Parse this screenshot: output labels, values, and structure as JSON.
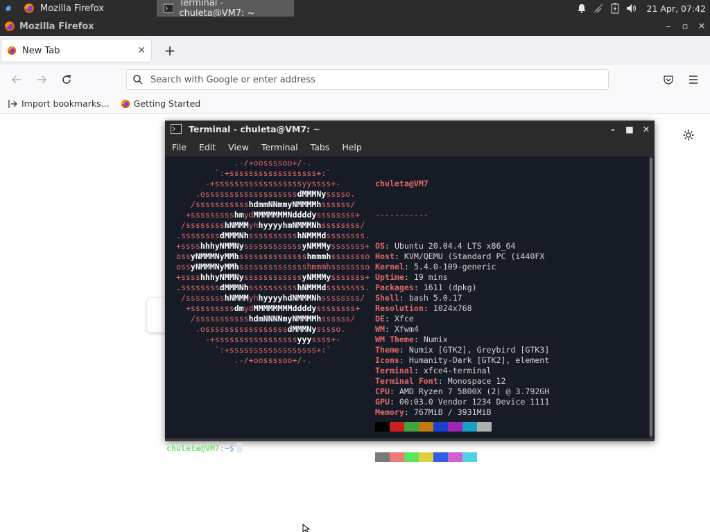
{
  "panel": {
    "tasks": [
      {
        "label": "Mozilla Firefox",
        "icon": "firefox-icon"
      },
      {
        "label": "Terminal - chuleta@VM7: ~",
        "icon": "terminal-icon"
      }
    ],
    "clock": "21 Apr, 07:42"
  },
  "firefox": {
    "window_title": "Mozilla Firefox",
    "tab_label": "New Tab",
    "search_placeholder": "Search with Google or enter address",
    "bookmarks": [
      "Import bookmarks...",
      "Getting Started"
    ]
  },
  "terminal": {
    "title": "Terminal - chuleta@VM7: ~",
    "menu": [
      "File",
      "Edit",
      "View",
      "Terminal",
      "Tabs",
      "Help"
    ],
    "logo_lines": [
      [
        [
          "              .-/+oossssoo+/-.",
          0
        ]
      ],
      [
        [
          "          `:+ssssssssssssssssss+:`",
          0
        ]
      ],
      [
        [
          "        -+ssssssssssssssssssyyssss+-",
          0
        ]
      ],
      [
        [
          "      .osssssssssssssssssss",
          0
        ],
        [
          "dMMMNy",
          1
        ],
        [
          "sssso.",
          0
        ]
      ],
      [
        [
          "     /sssssssssss",
          0
        ],
        [
          "hdmmNNmmyNMMMMh",
          1
        ],
        [
          "ssssss/",
          0
        ]
      ],
      [
        [
          "    +sssssssss",
          0
        ],
        [
          "hm",
          1
        ],
        [
          "yd",
          0
        ],
        [
          "MMMMMMMNddddy",
          1
        ],
        [
          "ssssssss+",
          0
        ]
      ],
      [
        [
          "   /ssssssss",
          0
        ],
        [
          "hNMMM",
          1
        ],
        [
          "yh",
          0
        ],
        [
          "hyyyyhmNMMMNh",
          1
        ],
        [
          "ssssssss/",
          0
        ]
      ],
      [
        [
          "  .ssssssss",
          0
        ],
        [
          "dMMMNh",
          1
        ],
        [
          "ssssssssss",
          0
        ],
        [
          "hNMMMd",
          1
        ],
        [
          "ssssssss.",
          0
        ]
      ],
      [
        [
          "  +ssss",
          0
        ],
        [
          "hhhyNMMNy",
          1
        ],
        [
          "ssssssssssss",
          0
        ],
        [
          "yNMMMy",
          1
        ],
        [
          "sssssss+",
          0
        ]
      ],
      [
        [
          "  oss",
          0
        ],
        [
          "yNMMMNyMMh",
          1
        ],
        [
          "ssssssssssssss",
          0
        ],
        [
          "hmmmh",
          1
        ],
        [
          "ssssssso",
          0
        ]
      ],
      [
        [
          "  oss",
          0
        ],
        [
          "yNMMMNyMMh",
          1
        ],
        [
          "sssssssssssssshmmmhssssssso",
          0
        ]
      ],
      [
        [
          "  +ssss",
          0
        ],
        [
          "hhhyNMMNy",
          1
        ],
        [
          "ssssssssssss",
          0
        ],
        [
          "yNMMMy",
          1
        ],
        [
          "sssssss+",
          0
        ]
      ],
      [
        [
          "  .ssssssss",
          0
        ],
        [
          "dMMMNh",
          1
        ],
        [
          "ssssssssss",
          0
        ],
        [
          "hNMMMd",
          1
        ],
        [
          "ssssssss.",
          0
        ]
      ],
      [
        [
          "   /ssssssss",
          0
        ],
        [
          "hNMMM",
          1
        ],
        [
          "yh",
          0
        ],
        [
          "hyyyyhdNMMMNh",
          1
        ],
        [
          "ssssssss/",
          0
        ]
      ],
      [
        [
          "    +sssssssss",
          0
        ],
        [
          "dm",
          1
        ],
        [
          "yd",
          0
        ],
        [
          "MMMMMMMMddddy",
          1
        ],
        [
          "ssssssss+",
          0
        ]
      ],
      [
        [
          "     /sssssssssss",
          0
        ],
        [
          "hdmNNNNmyNMMMMh",
          1
        ],
        [
          "ssssss/",
          0
        ]
      ],
      [
        [
          "      .osssssssssssssssss",
          0
        ],
        [
          "dMMMNy",
          1
        ],
        [
          "sssso.",
          0
        ]
      ],
      [
        [
          "        -+sssssssssssssssss",
          0
        ],
        [
          "yyy",
          1
        ],
        [
          "ssss+-",
          0
        ]
      ],
      [
        [
          "          `:+ssssssssssssssssss+:`",
          0
        ]
      ],
      [
        [
          "              .-/+oossssoo+/-.",
          0
        ]
      ]
    ],
    "userhost": "chuleta@VM7",
    "separator": "-----------",
    "info": [
      {
        "key": "OS",
        "value": "Ubuntu 20.04.4 LTS x86_64"
      },
      {
        "key": "Host",
        "value": "KVM/QEMU (Standard PC (i440FX"
      },
      {
        "key": "Kernel",
        "value": "5.4.0-109-generic"
      },
      {
        "key": "Uptime",
        "value": "19 mins"
      },
      {
        "key": "Packages",
        "value": "1611 (dpkg)"
      },
      {
        "key": "Shell",
        "value": "bash 5.0.17"
      },
      {
        "key": "Resolution",
        "value": "1024x768"
      },
      {
        "key": "DE",
        "value": "Xfce"
      },
      {
        "key": "WM",
        "value": "Xfwm4"
      },
      {
        "key": "WM Theme",
        "value": "Numix"
      },
      {
        "key": "Theme",
        "value": "Numix [GTK2], Greybird [GTK3]"
      },
      {
        "key": "Icons",
        "value": "Humanity-Dark [GTK2], element"
      },
      {
        "key": "Terminal",
        "value": "xfce4-terminal"
      },
      {
        "key": "Terminal Font",
        "value": "Monospace 12"
      },
      {
        "key": "CPU",
        "value": "AMD Ryzen 7 5800X (2) @ 3.792GH"
      },
      {
        "key": "GPU",
        "value": "00:03.0 Vendor 1234 Device 1111"
      },
      {
        "key": "Memory",
        "value": "767MiB / 3931MiB"
      }
    ],
    "palette_row1": [
      "#000000",
      "#cc1f1f",
      "#3fa53f",
      "#c47a0f",
      "#1c3fcf",
      "#9c27b0",
      "#17a0c0",
      "#b0b0b0"
    ],
    "palette_row2": [
      "#7a7a7a",
      "#f07a7a",
      "#5fe35f",
      "#e0d040",
      "#2f5fe0",
      "#d05fd0",
      "#4fd0e8",
      "#ffffff"
    ],
    "prompt_user": "chuleta@VM7",
    "prompt_path": ":~$"
  }
}
